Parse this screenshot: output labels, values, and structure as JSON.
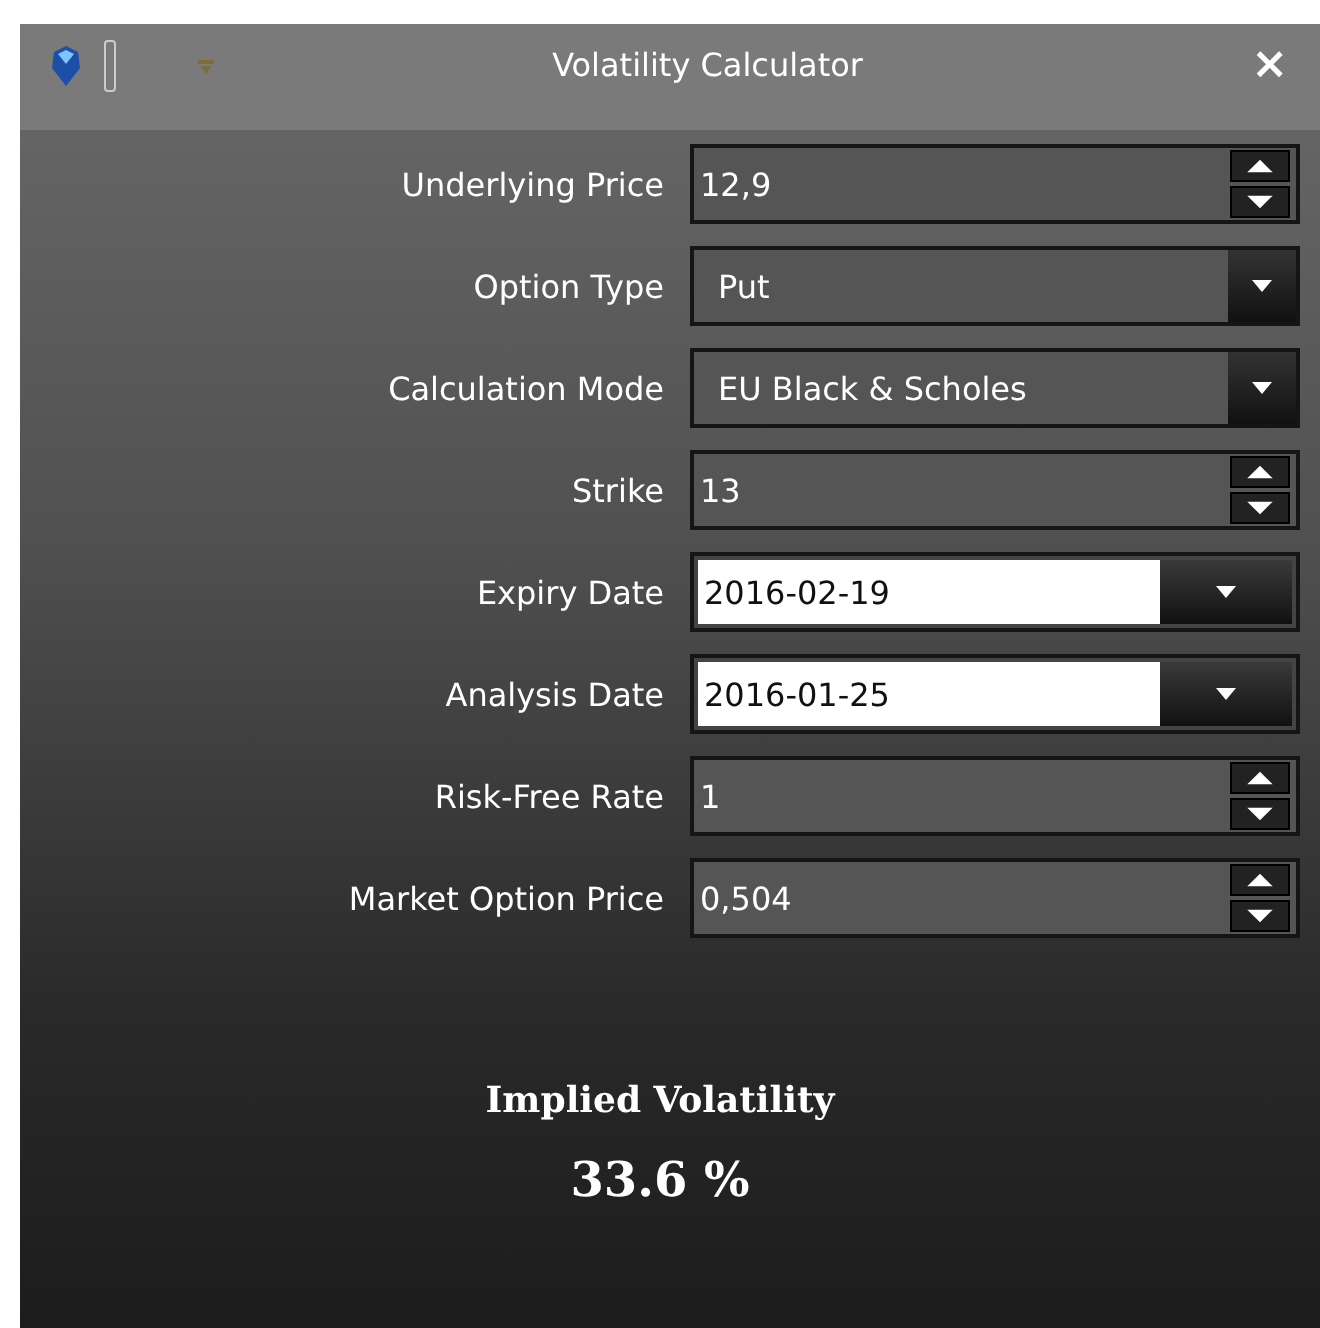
{
  "window": {
    "title": "Volatility Calculator",
    "close": "×"
  },
  "fields": [
    {
      "label": "Underlying Price",
      "kind": "spin",
      "value": "12,9"
    },
    {
      "label": "Option Type",
      "kind": "combo",
      "value": "Put"
    },
    {
      "label": "Calculation Mode",
      "kind": "combo",
      "value": "EU Black & Scholes"
    },
    {
      "label": "Strike",
      "kind": "spin",
      "value": "13"
    },
    {
      "label": "Expiry Date",
      "kind": "date",
      "value": "2016-02-19"
    },
    {
      "label": "Analysis Date",
      "kind": "date",
      "value": "2016-01-25"
    },
    {
      "label": "Risk-Free Rate",
      "kind": "spin",
      "value": "1"
    },
    {
      "label": "Market Option Price",
      "kind": "spin",
      "value": "0,504"
    }
  ],
  "result": {
    "label": "Implied Volatility",
    "value": "33.6 %"
  }
}
